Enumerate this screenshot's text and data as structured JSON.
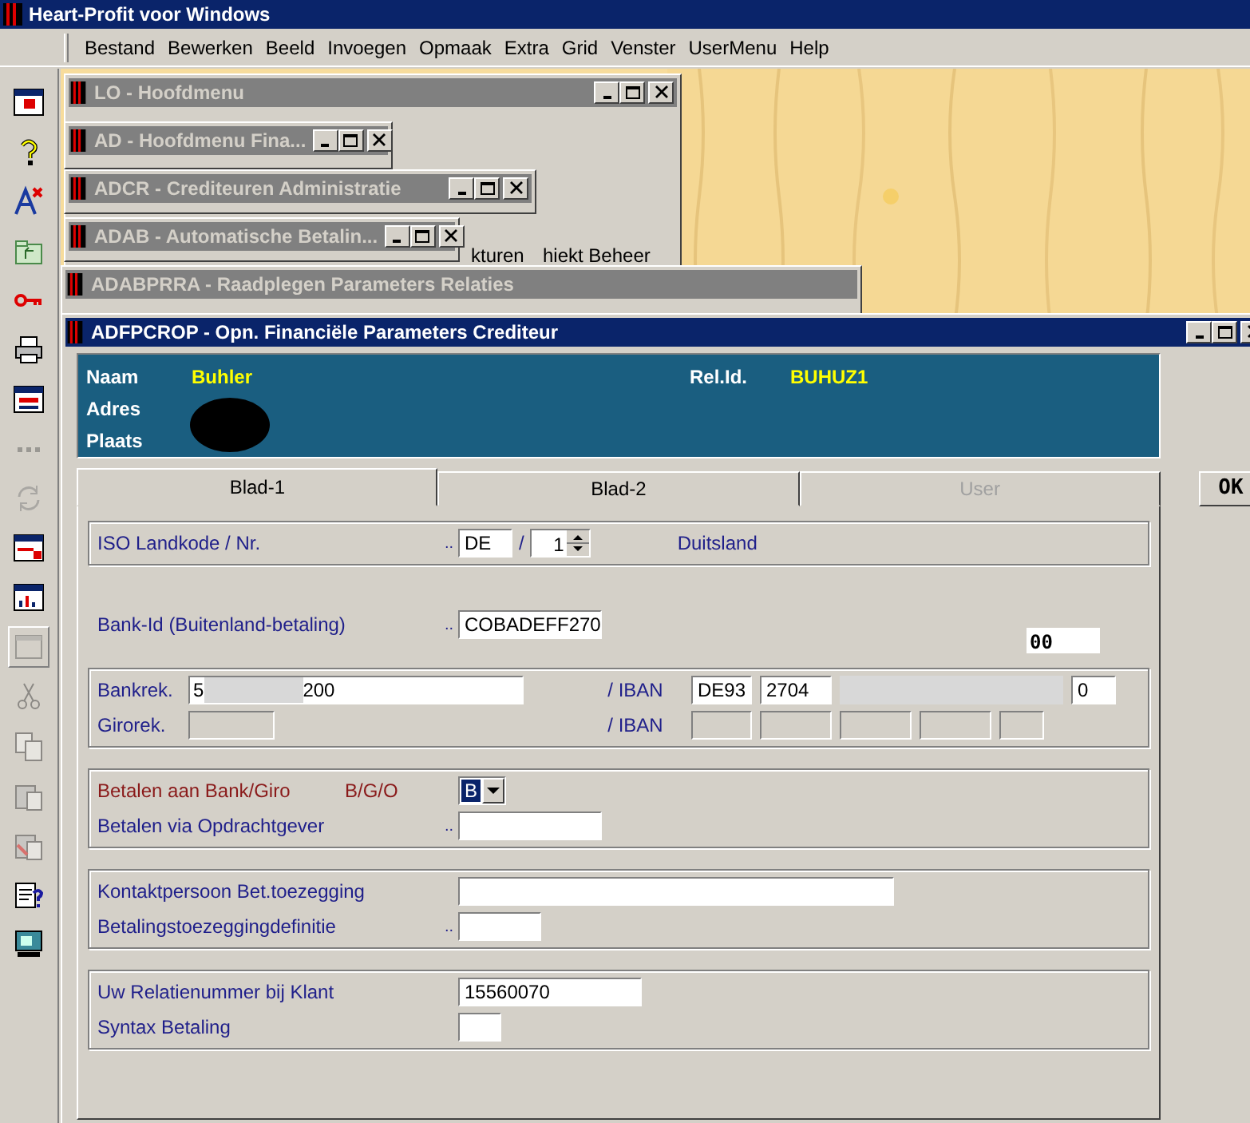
{
  "app_title": "Heart-Profit voor Windows",
  "menu": [
    {
      "label": "Bestand"
    },
    {
      "label": "Bewerken"
    },
    {
      "label": "Beeld"
    },
    {
      "label": "Invoegen"
    },
    {
      "label": "Opmaak"
    },
    {
      "label": "Extra"
    },
    {
      "label": "Grid"
    },
    {
      "label": "Venster"
    },
    {
      "label": "UserMenu"
    },
    {
      "label": "Help"
    }
  ],
  "toolbar": [
    {
      "kind": "window-red",
      "disabled": false,
      "pressed": false
    },
    {
      "kind": "help",
      "disabled": false,
      "pressed": false
    },
    {
      "kind": "font-delete",
      "disabled": false,
      "pressed": false
    },
    {
      "kind": "folder",
      "disabled": false,
      "pressed": false
    },
    {
      "kind": "key",
      "disabled": false,
      "pressed": false
    },
    {
      "kind": "printer",
      "disabled": false,
      "pressed": false
    },
    {
      "kind": "window-form",
      "disabled": false,
      "pressed": false
    },
    {
      "kind": "dots",
      "disabled": true,
      "pressed": false
    },
    {
      "kind": "refresh",
      "disabled": true,
      "pressed": false
    },
    {
      "kind": "window-lock",
      "disabled": false,
      "pressed": false
    },
    {
      "kind": "window-chart",
      "disabled": false,
      "pressed": false
    },
    {
      "kind": "window-plain",
      "disabled": true,
      "pressed": true
    },
    {
      "kind": "scissors",
      "disabled": true,
      "pressed": false
    },
    {
      "kind": "copy",
      "disabled": true,
      "pressed": false
    },
    {
      "kind": "paste",
      "disabled": true,
      "pressed": false
    },
    {
      "kind": "paste-delete",
      "disabled": true,
      "pressed": false
    },
    {
      "kind": "clipboard-help",
      "disabled": false,
      "pressed": false
    },
    {
      "kind": "monitor",
      "disabled": false,
      "pressed": false
    }
  ],
  "background_windows": [
    {
      "title": "LO - Hoofdmenu",
      "texts": [
        "kturen",
        "hiekt Beheer"
      ]
    },
    {
      "title": "AD - Hoofdmenu Fina..."
    },
    {
      "title": "ADCR - Crediteuren Administratie"
    },
    {
      "title": "ADAB - Automatische Betalin..."
    },
    {
      "title": "ADABPRRA - Raadplegen Parameters Relaties"
    }
  ],
  "window": {
    "title": "ADFPCROP - Opn. Financiële Parameters Crediteur"
  },
  "header": {
    "fields": [
      {
        "label": "Naam",
        "value": "Buhler"
      },
      {
        "label": "Adres"
      },
      {
        "label": "Plaats"
      }
    ],
    "rel_label": "Rel.Id.",
    "rel_value": "BUHUZ1"
  },
  "tabs": [
    {
      "label": "Blad-1",
      "selected": true,
      "disabled": false
    },
    {
      "label": "Blad-2",
      "selected": false,
      "disabled": false
    },
    {
      "label": "User",
      "selected": false,
      "disabled": true
    }
  ],
  "ok_button": "OK",
  "groups": [
    {
      "kind": "form",
      "bordered": true,
      "rows": [
        {
          "label": "ISO Landkode / Nr.",
          "mandatory": false,
          "items": [
            {
              "kind": "dots",
              "text": ".."
            },
            {
              "kind": "field",
              "value": "DE"
            },
            {
              "kind": "text",
              "text": "/"
            },
            {
              "kind": "spin",
              "value": "1"
            },
            {
              "kind": "note",
              "text": "Duitsland"
            }
          ]
        }
      ]
    },
    {
      "kind": "form",
      "bordered": false,
      "rows": [
        {
          "label": "Bank-Id (Buitenland-betaling)",
          "mandatory": false,
          "items": [
            {
              "kind": "dots",
              "text": ".."
            },
            {
              "kind": "field",
              "value": "COBADEFF270"
            },
            {
              "kind": "code",
              "text": "00"
            }
          ]
        }
      ]
    },
    {
      "kind": "account",
      "bordered": true,
      "rows": [
        {
          "label": "Bankrek.",
          "account": {
            "disabled": false,
            "parts": [
              "5",
              "200"
            ]
          },
          "iban_label": "/ IBAN",
          "iban": [
            {
              "value": "DE93",
              "disabled": false
            },
            {
              "value": "2704",
              "disabled": false
            },
            {
              "redacted": true
            },
            {
              "redacted": true
            },
            {
              "redacted": true
            },
            {
              "value": "0",
              "disabled": false
            }
          ]
        },
        {
          "label": "Girorek.",
          "account": {
            "disabled": true
          },
          "iban_label": "/ IBAN",
          "iban": [
            {
              "disabled": true
            },
            {
              "disabled": true
            },
            {
              "disabled": true
            },
            {
              "disabled": true
            },
            {
              "disabled": true
            }
          ]
        }
      ]
    },
    {
      "kind": "form",
      "bordered": true,
      "rows": [
        {
          "label": "Betalen aan Bank/Giro",
          "mandatory": true,
          "items": [
            {
              "kind": "caption",
              "text": "B/G/O",
              "mandatory": true
            },
            {
              "kind": "select",
              "value": "B"
            }
          ]
        },
        {
          "label": "Betalen via Opdrachtgever",
          "mandatory": false,
          "items": [
            {
              "kind": "dots",
              "text": ".."
            },
            {
              "kind": "field"
            }
          ]
        }
      ]
    },
    {
      "kind": "form",
      "bordered": true,
      "rows": [
        {
          "label": "Kontaktpersoon Bet.toezegging",
          "mandatory": false,
          "items": [
            {
              "kind": "field"
            }
          ]
        },
        {
          "label": "Betalingstoezeggingdefinitie",
          "mandatory": false,
          "items": [
            {
              "kind": "dots",
              "text": ".."
            },
            {
              "kind": "field"
            }
          ]
        }
      ]
    },
    {
      "kind": "form",
      "bordered": true,
      "rows": [
        {
          "label": "Uw Relatienummer bij Klant",
          "mandatory": false,
          "items": [
            {
              "kind": "field",
              "value": "15560070"
            }
          ]
        },
        {
          "label": "Syntax Betaling",
          "mandatory": false,
          "items": [
            {
              "kind": "field"
            }
          ]
        }
      ]
    }
  ]
}
